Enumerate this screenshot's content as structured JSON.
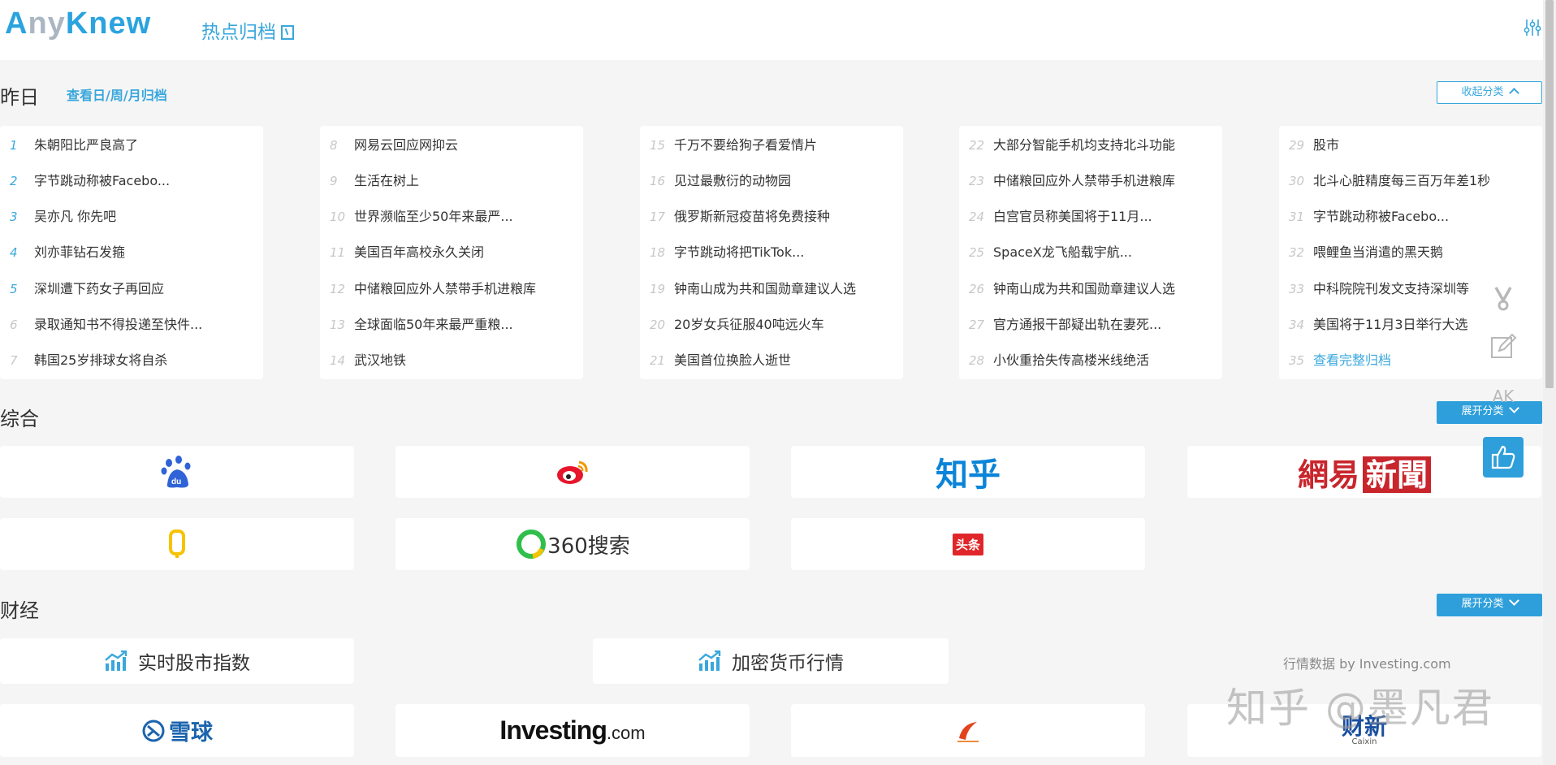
{
  "header": {
    "logo_parts": [
      "A",
      "ny",
      "Knew"
    ],
    "hot_archive": "热点归档"
  },
  "yesterday": {
    "title": "昨日",
    "archive_link": "查看日/周/月归档",
    "collapse": "收起分类",
    "columns": [
      [
        {
          "num": "1",
          "text": "朱朝阳比严良高了"
        },
        {
          "num": "2",
          "text": "字节跳动称被Facebo..."
        },
        {
          "num": "3",
          "text": "吴亦凡 你先吧"
        },
        {
          "num": "4",
          "text": "刘亦菲钻石发箍"
        },
        {
          "num": "5",
          "text": "深圳遭下药女子再回应"
        },
        {
          "num": "6",
          "text": "录取通知书不得投递至快件..."
        },
        {
          "num": "7",
          "text": "韩国25岁排球女将自杀"
        }
      ],
      [
        {
          "num": "8",
          "text": "网易云回应网抑云"
        },
        {
          "num": "9",
          "text": "生活在树上"
        },
        {
          "num": "10",
          "text": "世界濒临至少50年来最严..."
        },
        {
          "num": "11",
          "text": "美国百年高校永久关闭"
        },
        {
          "num": "12",
          "text": "中储粮回应外人禁带手机进粮库"
        },
        {
          "num": "13",
          "text": "全球面临50年来最严重粮..."
        },
        {
          "num": "14",
          "text": "武汉地铁"
        }
      ],
      [
        {
          "num": "15",
          "text": "千万不要给狗子看爱情片"
        },
        {
          "num": "16",
          "text": "见过最敷衍的动物园"
        },
        {
          "num": "17",
          "text": "俄罗斯新冠疫苗将免费接种"
        },
        {
          "num": "18",
          "text": "字节跳动将把TikTok..."
        },
        {
          "num": "19",
          "text": "钟南山成为共和国勋章建议人选"
        },
        {
          "num": "20",
          "text": "20岁女兵征服40吨远火车"
        },
        {
          "num": "21",
          "text": "美国首位换脸人逝世"
        }
      ],
      [
        {
          "num": "22",
          "text": "大部分智能手机均支持北斗功能"
        },
        {
          "num": "23",
          "text": "中储粮回应外人禁带手机进粮库"
        },
        {
          "num": "24",
          "text": "白宫官员称美国将于11月..."
        },
        {
          "num": "25",
          "text": "SpaceX龙飞船载宇航..."
        },
        {
          "num": "26",
          "text": "钟南山成为共和国勋章建议人选"
        },
        {
          "num": "27",
          "text": "官方通报干部疑出轨在妻死..."
        },
        {
          "num": "28",
          "text": "小伙重拾失传高楼米线绝活"
        }
      ],
      [
        {
          "num": "29",
          "text": "股市"
        },
        {
          "num": "30",
          "text": "北斗心脏精度每三百万年差1秒"
        },
        {
          "num": "31",
          "text": "字节跳动称被Facebo..."
        },
        {
          "num": "32",
          "text": "喂鲤鱼当消遣的黑天鹅"
        },
        {
          "num": "33",
          "text": "中科院院刊发文支持深圳等"
        },
        {
          "num": "34",
          "text": "美国将于11月3日举行大选"
        },
        {
          "num": "35",
          "text": "查看完整归档"
        }
      ]
    ]
  },
  "general": {
    "title": "综合",
    "expand": "展开分类",
    "zhihu": "知乎",
    "wangyi": [
      "網易",
      "新聞"
    ],
    "s360": "360搜索",
    "toutiao": "头条"
  },
  "finance": {
    "title": "财经",
    "expand": "展开分类",
    "stock_index": "实时股市指数",
    "crypto": "加密货币行情",
    "quote_source": "行情数据 by Investing.com",
    "xueqiu": "雪球",
    "investing": "Investing",
    "investing_suffix": ".com",
    "caixin_zh": "财新",
    "caixin_en": "Caixin"
  },
  "sidebar": {
    "ak": "AK"
  },
  "watermark": "知乎 @墨凡君",
  "colors": {
    "accent": "#2e9fdb",
    "background": "#f5f5f5",
    "wangyi_red": "#c8262c"
  }
}
